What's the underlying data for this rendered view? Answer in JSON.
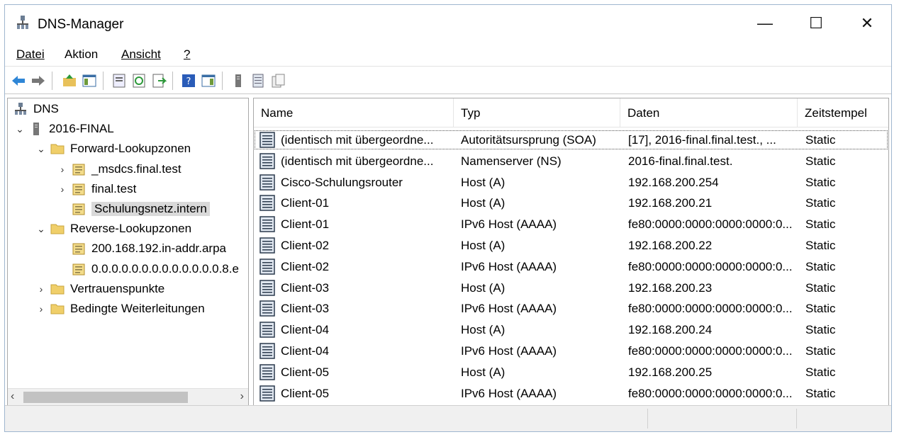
{
  "window": {
    "title": "DNS-Manager",
    "minimize": "—",
    "maximize": "☐",
    "close": "✕"
  },
  "menu": [
    "Datei",
    "Aktion",
    "Ansicht",
    "?"
  ],
  "tree": [
    {
      "label": "DNS",
      "level": 0,
      "expander": "",
      "icon": "dns-icon"
    },
    {
      "label": "2016-FINAL",
      "level": 0,
      "expander": "⌄",
      "icon": "server-icon"
    },
    {
      "label": "Forward-Lookupzonen",
      "level": 1,
      "expander": "⌄",
      "icon": "folder-icon"
    },
    {
      "label": "_msdcs.final.test",
      "level": 2,
      "expander": "›",
      "icon": "zone-icon"
    },
    {
      "label": "final.test",
      "level": 2,
      "expander": "›",
      "icon": "zone-icon"
    },
    {
      "label": "Schulungsnetz.intern",
      "level": 2,
      "expander": "",
      "icon": "zone-icon",
      "selected": true
    },
    {
      "label": "Reverse-Lookupzonen",
      "level": 1,
      "expander": "⌄",
      "icon": "folder-icon"
    },
    {
      "label": "200.168.192.in-addr.arpa",
      "level": 2,
      "expander": "",
      "icon": "zone-icon"
    },
    {
      "label": "0.0.0.0.0.0.0.0.0.0.0.0.0.8.e",
      "level": 2,
      "expander": "",
      "icon": "zone-icon"
    },
    {
      "label": "Vertrauenspunkte",
      "level": 1,
      "expander": "›",
      "icon": "folder-icon"
    },
    {
      "label": "Bedingte Weiterleitungen",
      "level": 1,
      "expander": "›",
      "icon": "folder-icon"
    }
  ],
  "columns": [
    "Name",
    "Typ",
    "Daten",
    "Zeitstempel"
  ],
  "records": [
    [
      "(identisch mit übergeordne...",
      "Autoritätsursprung (SOA)",
      "[17], 2016-final.final.test., ...",
      "Static"
    ],
    [
      "(identisch mit übergeordne...",
      "Namenserver (NS)",
      "2016-final.final.test.",
      "Static"
    ],
    [
      "Cisco-Schulungsrouter",
      "Host (A)",
      "192.168.200.254",
      "Static"
    ],
    [
      "Client-01",
      "Host (A)",
      "192.168.200.21",
      "Static"
    ],
    [
      "Client-01",
      "IPv6 Host (AAAA)",
      "fe80:0000:0000:0000:0000:0...",
      "Static"
    ],
    [
      "Client-02",
      "Host (A)",
      "192.168.200.22",
      "Static"
    ],
    [
      "Client-02",
      "IPv6 Host (AAAA)",
      "fe80:0000:0000:0000:0000:0...",
      "Static"
    ],
    [
      "Client-03",
      "Host (A)",
      "192.168.200.23",
      "Static"
    ],
    [
      "Client-03",
      "IPv6 Host (AAAA)",
      "fe80:0000:0000:0000:0000:0...",
      "Static"
    ],
    [
      "Client-04",
      "Host (A)",
      "192.168.200.24",
      "Static"
    ],
    [
      "Client-04",
      "IPv6 Host (AAAA)",
      "fe80:0000:0000:0000:0000:0...",
      "Static"
    ],
    [
      "Client-05",
      "Host (A)",
      "192.168.200.25",
      "Static"
    ],
    [
      "Client-05",
      "IPv6 Host (AAAA)",
      "fe80:0000:0000:0000:0000:0...",
      "Static"
    ]
  ]
}
